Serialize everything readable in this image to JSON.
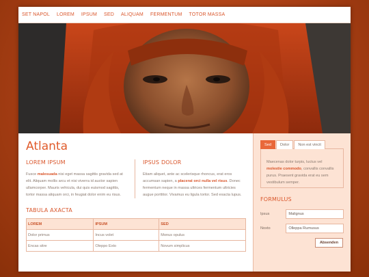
{
  "nav": [
    "SET NAPOL",
    "LOREM",
    "IPSUM",
    "SED",
    "ALIQUAM",
    "FERMENTUM",
    "TOTOR MASSA"
  ],
  "page_title": "Atlanta",
  "left_col": {
    "heading": "LOREM IPSUM",
    "text_before": "Fusce ",
    "highlight": "malesuada",
    "text_after": " nisi eget massa sagittis gravida sed at elit. Aliquam mollis arcu et nisi viverra id auctor sapien ullamcorper. Mauris vehicula, dui quis euismod sagittis, tortor massa aliquam orci, in feugiat dolor enim eu risus."
  },
  "right_col": {
    "heading": "IPSUS DOLOR",
    "text_before": "Etiam aliquet, ante ac scelerisque rhoncus, erat eros accumsan sapien, a ",
    "highlight": "placerat orci nulla vel risus",
    "text_after": ". Donec fermentum neque in massa ultrices fermentum ultricies augue porttitor. Vivamus eu ligula tortor. Sed exacta lupus."
  },
  "table": {
    "title": "TABULA AXACTA",
    "headers": [
      "LOREM",
      "IPSUM",
      "SED"
    ],
    "rows": [
      [
        "Dolor primus",
        "Incus volet",
        "Monus opulus"
      ],
      [
        "Encas sitre",
        "Oleppo Exto",
        "Novum simplicus"
      ]
    ]
  },
  "sidebar": {
    "tabs": [
      "Sed",
      "Dolor",
      "Non est vincit"
    ],
    "active_tab": "Sed",
    "tab_text_before": "Maecenas dolor turpis, luctus vel ",
    "tab_highlight": "molestie commodo",
    "tab_text_after": ", convallis convallis purus. Praesent gravida erat eu sem vestibulum semper."
  },
  "form": {
    "title": "FORMULUS",
    "field1_label": "Ipsus",
    "field1_value": "Malignus",
    "field2_label": "Noxto",
    "field2_value": "Olleppa Rumusus",
    "submit_label": "Absenden"
  },
  "colors": {
    "accent": "#e05b2b",
    "background": "#a93f15",
    "sidebar_bg": "#fde3d4"
  }
}
